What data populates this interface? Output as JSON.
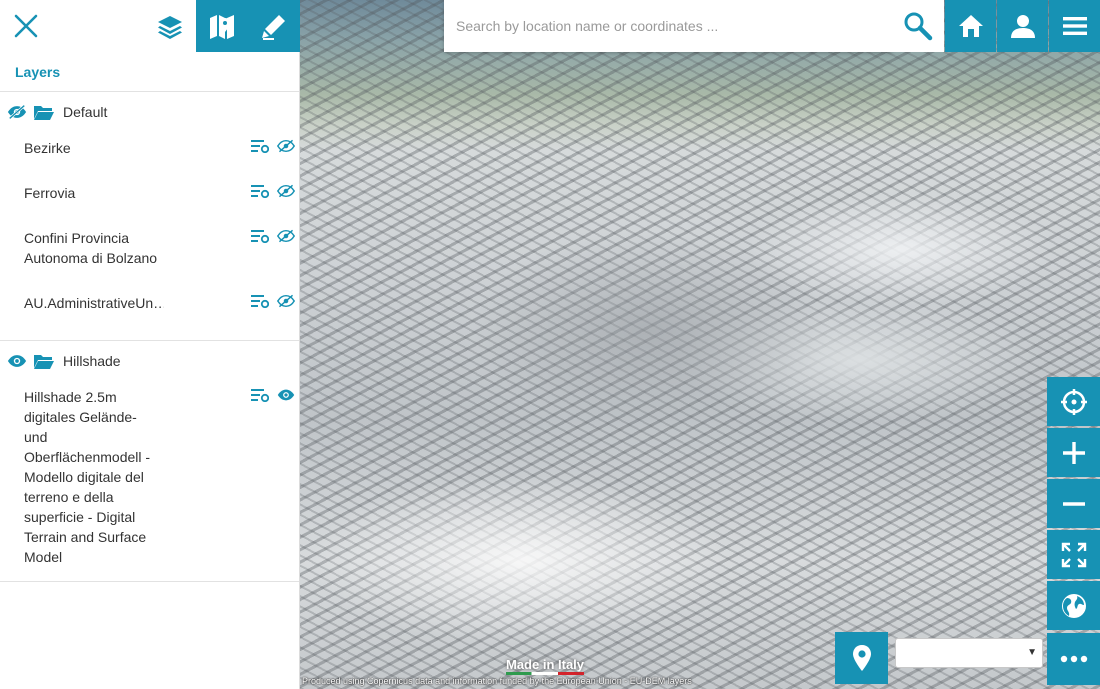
{
  "sidebar": {
    "title": "Layers",
    "tabs": [
      {
        "icon": "layers-icon"
      },
      {
        "icon": "map-icon"
      },
      {
        "icon": "pen-icon"
      }
    ],
    "groups": [
      {
        "name": "Default",
        "visible": false,
        "layers": [
          {
            "name": "Bezirke",
            "visible": false
          },
          {
            "name": "Ferrovia",
            "visible": false
          },
          {
            "name": "Confini Provincia Autonoma di Bolzano",
            "visible": false
          },
          {
            "name": "AU.AdministrativeUn…",
            "visible": false
          }
        ]
      },
      {
        "name": "Hillshade",
        "visible": true,
        "layers": [
          {
            "name": "Hillshade 2.5m digitales Gelände- und Oberflächenmodell - Modello digitale del terreno e della superficie - Digital Terrain and Surface Model",
            "visible": true
          }
        ]
      }
    ]
  },
  "search": {
    "placeholder": "Search by location name or coordinates ..."
  },
  "map": {
    "attribution": "Produced using Copernicus data and information funded by the European Union - EU-DEM layers",
    "made_in": "Made in Italy",
    "base_select_value": ""
  },
  "colors": {
    "accent": "#1792b4",
    "title": "#1792b4"
  }
}
